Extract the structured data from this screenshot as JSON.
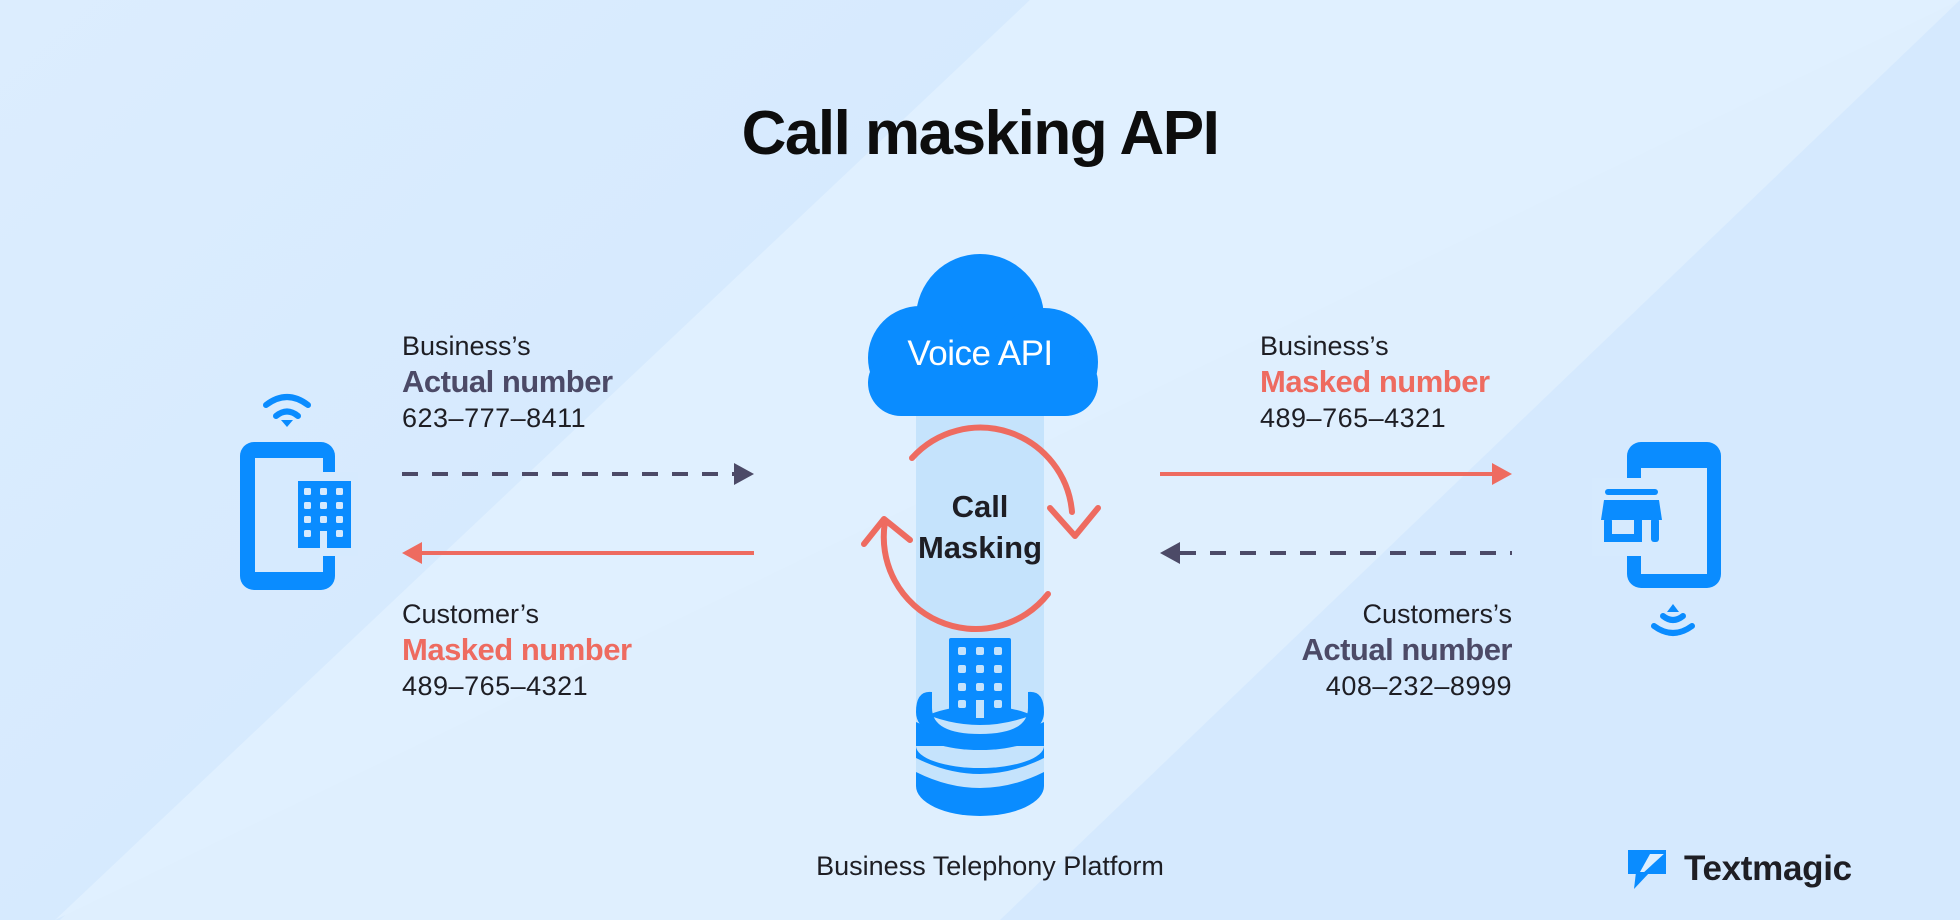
{
  "title": "Call masking API",
  "colors": {
    "background": "#dfeffe",
    "background_dark": "#d3e8fd",
    "accent_blue": "#0a8cff",
    "pale_blue": "#c5e3fc",
    "masked_red": "#ee6b60",
    "actual_slate": "#4c4a67",
    "text_dark": "#1e1e24"
  },
  "left_party": {
    "icon": "business-phone-icon",
    "signal_icon": "wifi-icon",
    "outgoing": {
      "owner": "Business’s",
      "kind": "Actual number",
      "number": "623–777–8411",
      "arrow": "dashed-right"
    },
    "incoming": {
      "owner": "Customer’s",
      "kind": "Masked number",
      "number": "489–765–4321",
      "arrow": "solid-left"
    }
  },
  "center": {
    "cloud_label": "Voice API",
    "core_label_line1": "Call",
    "core_label_line2": "Masking",
    "cycle_icon": "refresh-cycle-icon",
    "building_icon": "building-icon",
    "database_icon": "database-icon",
    "platform_label": "Business Telephony Platform"
  },
  "right_party": {
    "icon": "store-phone-icon",
    "signal_icon": "signal-icon",
    "outgoing": {
      "owner": "Business’s",
      "kind": "Masked number",
      "number": "489–765–4321",
      "arrow": "solid-right"
    },
    "incoming": {
      "owner": "Customers’s",
      "kind": "Actual number",
      "number": "408–232–8999",
      "arrow": "dashed-left"
    }
  },
  "brand": {
    "name": "Textmagic",
    "logo_icon": "textmagic-logo-icon"
  }
}
